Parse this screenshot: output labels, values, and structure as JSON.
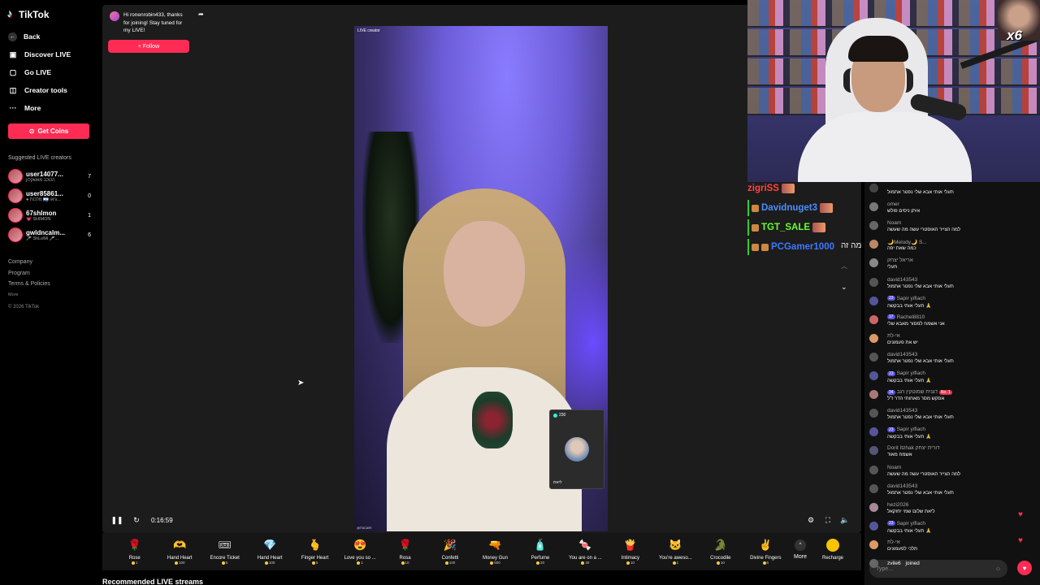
{
  "sidebar": {
    "logo": "TikTok",
    "nav": [
      {
        "label": "Back",
        "icon": "back-arrow-icon"
      },
      {
        "label": "Discover LIVE",
        "icon": "discover-live-icon"
      },
      {
        "label": "Go LIVE",
        "icon": "go-live-icon"
      },
      {
        "label": "Creator tools",
        "icon": "creator-tools-icon"
      },
      {
        "label": "More",
        "icon": "more-dots-icon"
      }
    ],
    "get_coins": "Get Coins",
    "suggested_title": "Suggested LIVE creators",
    "creators": [
      {
        "name": "user14077...",
        "sub": "הכוכב מאשקלון",
        "count": "7"
      },
      {
        "name": "user85861...",
        "sub": "● מלכות 🇮🇱 גיאו...",
        "count": "0"
      },
      {
        "name": "67shlmon",
        "sub": "💗 SHIMON",
        "count": "1"
      },
      {
        "name": "gwldncalm...",
        "sub": "🎤 ShLoMi 🎤...",
        "count": "6"
      }
    ],
    "footer_links": [
      "Company",
      "Program",
      "Terms & Policies"
    ],
    "footer_more": "More",
    "copyright": "© 2026 TikTok"
  },
  "player": {
    "join_message": "Hi ronenrobin433, thanks for joining! Stay tuned for my LIVE!",
    "follow_label": "+ Follow",
    "live_tag": "LIVE creator",
    "video_bottom_tag": "@חשבונות",
    "pip_count": "230",
    "pip_name": "ליאת",
    "time": "0:16:59"
  },
  "gifts": [
    {
      "name": "Rose",
      "price": "1",
      "icon": "🌹"
    },
    {
      "name": "Hand Heart",
      "price": "100",
      "icon": "🫶"
    },
    {
      "name": "Encore Ticket",
      "price": "5",
      "icon": "🎟"
    },
    {
      "name": "Hand Heart",
      "price": "100",
      "icon": "💎"
    },
    {
      "name": "Finger Heart",
      "price": "5",
      "icon": "🫰"
    },
    {
      "name": "Love you so ...",
      "price": "1",
      "icon": "😍"
    },
    {
      "name": "Rosa",
      "price": "10",
      "icon": "🌹"
    },
    {
      "name": "Confetti",
      "price": "100",
      "icon": "🎉"
    },
    {
      "name": "Money Gun",
      "price": "500",
      "icon": "🔫"
    },
    {
      "name": "Perfume",
      "price": "20",
      "icon": "🧴"
    },
    {
      "name": "You are on a ...",
      "price": "30",
      "icon": "🍬"
    },
    {
      "name": "Intimacy",
      "price": "10",
      "icon": "🍟"
    },
    {
      "name": "You're aweso...",
      "price": "1",
      "icon": "🐱"
    },
    {
      "name": "Crocodile",
      "price": "10",
      "icon": "🐊"
    },
    {
      "name": "Divine Fingers",
      "price": "6",
      "icon": "✌"
    }
  ],
  "gift_more": "More",
  "recharge": "Recharge",
  "recommended": "Recommended LIVE streams",
  "overlay_chat": [
    {
      "name": "zigriSS",
      "color": "#ff4444"
    },
    {
      "name": "Davidnuget3",
      "color": "#4a8cff"
    },
    {
      "name": "TGT_SALE",
      "color": "#66ff33"
    },
    {
      "name": "PCGamer1000",
      "color": "#3a7bff"
    }
  ],
  "overlay_message": "חחחחחחחחחחח מה זה",
  "chat": [
    {
      "name": "",
      "text": "תעלי אותי אבא שלי נפטר אתמול"
    },
    {
      "name": "omer",
      "text": "איתן ניסים פולש"
    },
    {
      "name": "Noam",
      "text": "למה הצייר האוסטרי עשה מה שעשה"
    },
    {
      "name": "🌙Melody🌙 S...",
      "text": "כמה שאת יפה"
    },
    {
      "name": "אריאל יצחק",
      "text": "תעלי"
    },
    {
      "name": "david143543",
      "text": "תעלי אותי אבא שלי נפטר אתמול"
    },
    {
      "name": "Sapir yiflach",
      "badge": "23",
      "text": "תעלי אותי בבקשה 🙏"
    },
    {
      "name": "Rachel8810",
      "badge": "37",
      "text": "אני אשמח למסור מאבא שלי"
    },
    {
      "name": "אי-לת",
      "text": "יש את פעמונים"
    },
    {
      "name": "david143543",
      "text": "תעלי אותי אבא שלי נפטר אתמול"
    },
    {
      "name": "Sapir yiflach",
      "badge": "23",
      "text": "תעלי אותי בבקשה 🙏"
    },
    {
      "name": "דגנית שמוטקין רגב",
      "badge": "34",
      "badge2": "No. 1",
      "text": "אסקש מסר מאחותי הדר ז\"ל"
    },
    {
      "name": "david143543",
      "text": "תעלי אותי אבא שלי נפטר אתמול"
    },
    {
      "name": "Sapir yiflach",
      "badge": "23",
      "text": "תעלי אותי בבקשה 🙏"
    },
    {
      "name": "Dorit Itzhak דורית יצחק",
      "text": "אשמח מאוד"
    },
    {
      "name": "Noam",
      "text": "למה הצייר האוסטרי עשה מה שעשה"
    },
    {
      "name": "david143543",
      "text": "תעלי אותי אבא שלי נפטר אתמול"
    },
    {
      "name": "hezi2026",
      "text": "ליאת שלום שמי יחזקאל"
    },
    {
      "name": "Sapir yiflach",
      "badge": "23",
      "text": "תעלי אותי בבקשה 🙏"
    },
    {
      "name": "אי-לת",
      "text": "תלכי לפעמונים"
    },
    {
      "name": "zvile6",
      "text": "joined"
    }
  ],
  "chat_placeholder": "Type..."
}
